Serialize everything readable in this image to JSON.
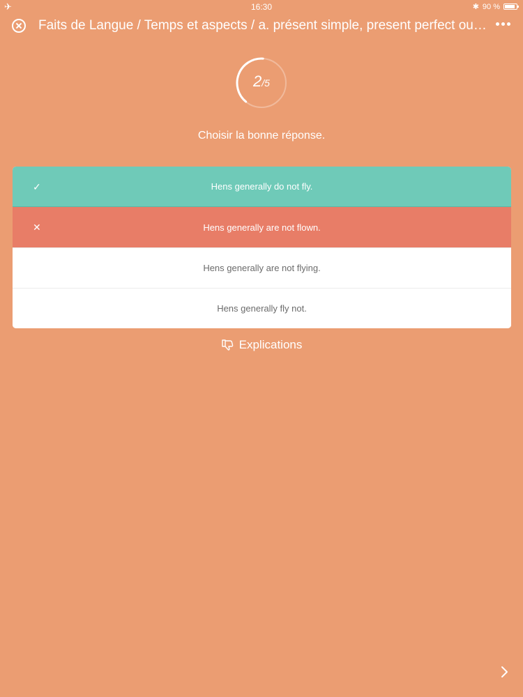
{
  "status_bar": {
    "time": "16:30",
    "battery": "90 %"
  },
  "header": {
    "title": "Faits de Langue / Temps et aspects / a. présent simple, present perfect ou b…"
  },
  "progress": {
    "current": "2",
    "total": "/5",
    "fraction": 0.4
  },
  "instruction": "Choisir la bonne réponse.",
  "answers": [
    {
      "text": "Hens generally do not fly.",
      "state": "correct",
      "mark": "✓"
    },
    {
      "text": "Hens generally are not flown.",
      "state": "wrong",
      "mark": "✕"
    },
    {
      "text": "Hens generally are not flying.",
      "state": "neutral",
      "mark": ""
    },
    {
      "text": "Hens generally fly not.",
      "state": "neutral",
      "mark": ""
    }
  ],
  "explications_label": "Explications",
  "colors": {
    "background": "#EB9D72",
    "correct": "#6FCAB8",
    "wrong": "#E87D67"
  }
}
